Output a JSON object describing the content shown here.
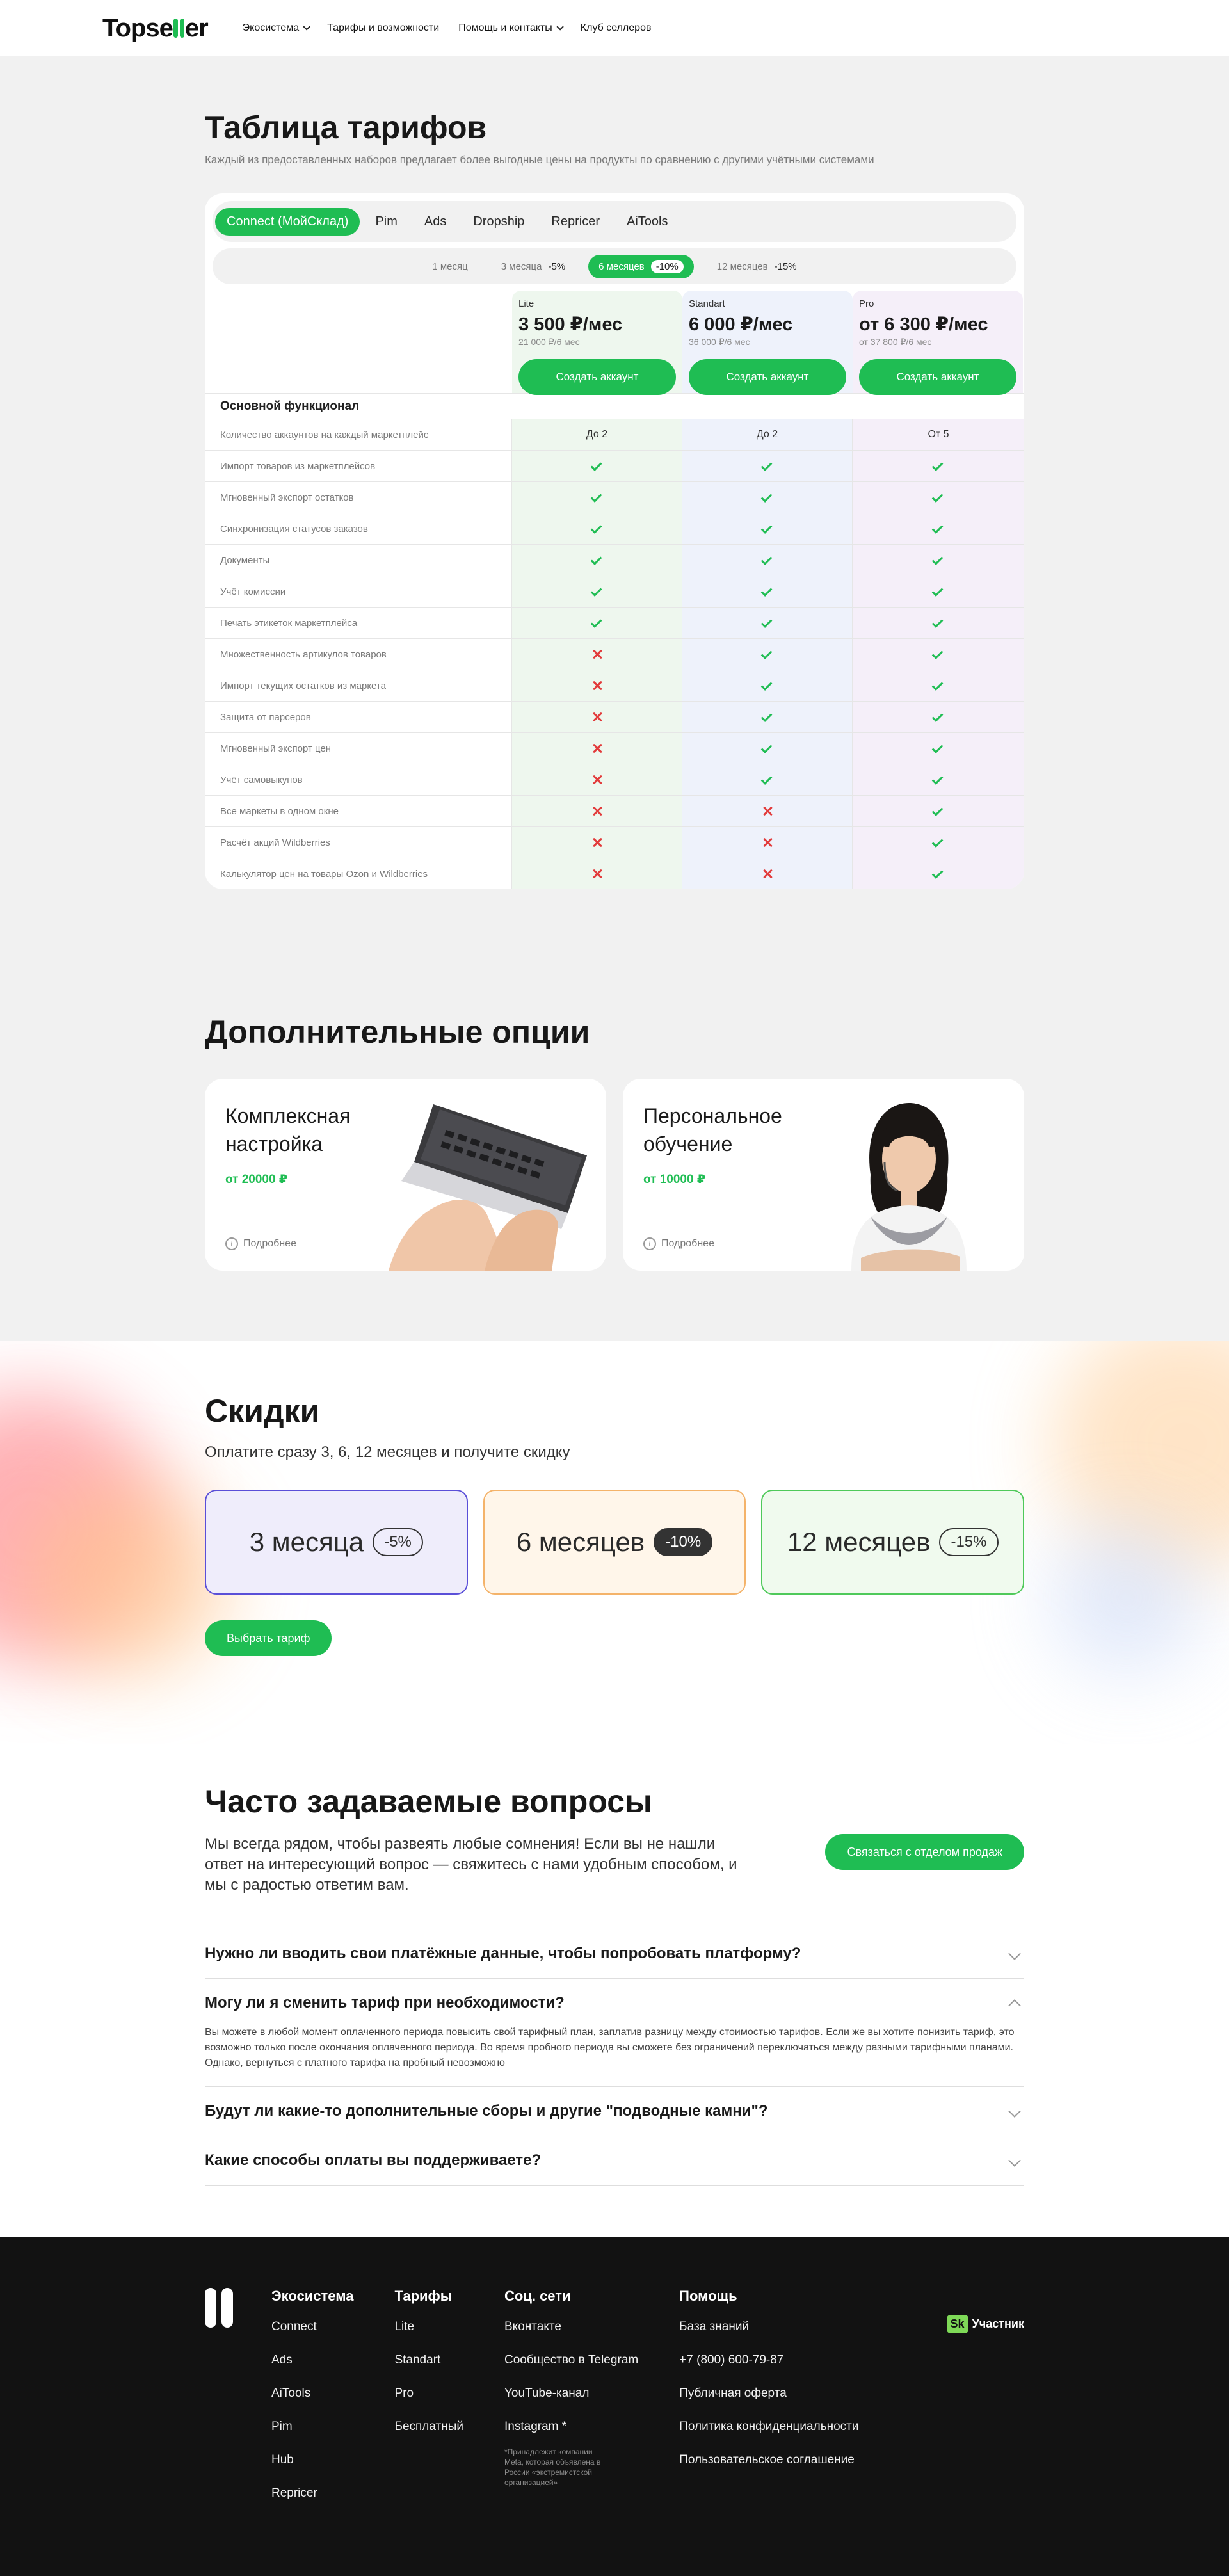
{
  "header": {
    "logo": "Topseller",
    "nav": [
      {
        "label": "Экосистема",
        "dropdown": true
      },
      {
        "label": "Тарифы и возможности",
        "dropdown": false
      },
      {
        "label": "Помощь и контакты",
        "dropdown": true
      },
      {
        "label": "Клуб селлеров",
        "dropdown": false
      }
    ]
  },
  "pricing": {
    "title": "Таблица тарифов",
    "subtitle": "Каждый из предоставленных наборов предлагает более выгодные цены на продукты по сравнению с другими учётными системами",
    "tabs": [
      "Connect (МойСклад)",
      "Pim",
      "Ads",
      "Dropship",
      "Repricer",
      "AiTools"
    ],
    "active_tab": 0,
    "periods": [
      {
        "label": "1 месяц",
        "discount": ""
      },
      {
        "label": "3 месяца",
        "discount": "-5%"
      },
      {
        "label": "6 месяцев",
        "discount": "-10%"
      },
      {
        "label": "12 месяцев",
        "discount": "-15%"
      }
    ],
    "active_period": 2,
    "plans": [
      {
        "name": "Lite",
        "price": "3 500 ₽/мес",
        "price_period": "21 000 ₽/6 мес",
        "button": "Создать аккаунт"
      },
      {
        "name": "Standart",
        "price": "6 000 ₽/мес",
        "price_period": "36 000 ₽/6 мес",
        "button": "Создать аккаунт"
      },
      {
        "name": "Pro",
        "price": "от 6 300 ₽/мес",
        "price_period": "от 37 800 ₽/6 мес",
        "button": "Создать аккаунт"
      }
    ],
    "section_title": "Основной функционал",
    "features": [
      {
        "label": "Количество аккаунтов на каждый маркетплейс",
        "values": [
          "До 2",
          "До 2",
          "От 5"
        ]
      },
      {
        "label": "Импорт товаров из маркетплейсов",
        "values": [
          "yes",
          "yes",
          "yes"
        ]
      },
      {
        "label": "Мгновенный экспорт остатков",
        "values": [
          "yes",
          "yes",
          "yes"
        ]
      },
      {
        "label": "Синхронизация статусов заказов",
        "values": [
          "yes",
          "yes",
          "yes"
        ]
      },
      {
        "label": "Документы",
        "values": [
          "yes",
          "yes",
          "yes"
        ]
      },
      {
        "label": "Учёт комиссии",
        "values": [
          "yes",
          "yes",
          "yes"
        ]
      },
      {
        "label": "Печать этикеток маркетплейса",
        "values": [
          "yes",
          "yes",
          "yes"
        ]
      },
      {
        "label": "Множественность артикулов товаров",
        "values": [
          "no",
          "yes",
          "yes"
        ]
      },
      {
        "label": "Импорт текущих остатков из маркета",
        "values": [
          "no",
          "yes",
          "yes"
        ]
      },
      {
        "label": "Защита от парсеров",
        "values": [
          "no",
          "yes",
          "yes"
        ]
      },
      {
        "label": "Мгновенный экспорт цен",
        "values": [
          "no",
          "yes",
          "yes"
        ]
      },
      {
        "label": "Учёт самовыкупов",
        "values": [
          "no",
          "yes",
          "yes"
        ]
      },
      {
        "label": "Все маркеты в одном окне",
        "values": [
          "no",
          "no",
          "yes"
        ]
      },
      {
        "label": "Расчёт акций Wildberries",
        "values": [
          "no",
          "no",
          "yes"
        ]
      },
      {
        "label": "Калькулятор цен на товары Ozon и Wildberries",
        "values": [
          "no",
          "no",
          "yes"
        ]
      }
    ]
  },
  "options": {
    "title": "Дополнительные опции",
    "cards": [
      {
        "title": "Комплексная настройка",
        "price": "от 20000 ₽",
        "more": "Подробнее",
        "image": "laptop-hands-image"
      },
      {
        "title": "Персональное обучение",
        "price": "от 10000 ₽",
        "more": "Подробнее",
        "image": "support-operator-image"
      }
    ]
  },
  "discounts": {
    "title": "Скидки",
    "subtitle": "Оплатите сразу 3, 6, 12 месяцев и получите скидку",
    "cards": [
      {
        "label": "3 месяца",
        "discount": "-5%"
      },
      {
        "label": "6 месяцев",
        "discount": "-10%"
      },
      {
        "label": "12 месяцев",
        "discount": "-15%"
      }
    ],
    "button": "Выбрать тариф"
  },
  "faq": {
    "title": "Часто задаваемые вопросы",
    "description": "Мы всегда рядом, чтобы развеять любые сомнения! Если вы не нашли ответ на интересующий вопрос — свяжитесь с нами удобным способом, и мы с радостью ответим вам.",
    "contact_button": "Связаться с отделом продаж",
    "items": [
      {
        "question": "Нужно ли вводить свои платёжные данные, чтобы попробовать платформу?",
        "answer": "",
        "open": false
      },
      {
        "question": "Могу ли я сменить тариф при необходимости?",
        "answer": "Вы можете в любой момент оплаченного периода повысить свой тарифный план, заплатив разницу между стоимостью тарифов. Если же вы хотите понизить тариф, это возможно только после окончания оплаченного периода. Во время пробного периода вы сможете без ограничений переключаться между разными тарифными планами. Однако, вернуться с платного тарифа на пробный невозможно",
        "open": true
      },
      {
        "question": "Будут ли какие-то дополнительные сборы и другие \"подводные камни\"?",
        "answer": "",
        "open": false
      },
      {
        "question": "Какие способы оплаты вы поддерживаете?",
        "answer": "",
        "open": false
      }
    ]
  },
  "footer": {
    "columns": [
      {
        "title": "Экосистема",
        "items": [
          "Connect",
          "Ads",
          "AiTools",
          "Pim",
          "Hub",
          "Repricer"
        ]
      },
      {
        "title": "Тарифы",
        "items": [
          "Lite",
          "Standart",
          "Pro",
          "Бесплатный"
        ]
      },
      {
        "title": "Соц. сети",
        "items": [
          "Вконтакте",
          "Сообщество в Telegram",
          "YouTube-канал",
          "Instagram *"
        ]
      },
      {
        "title": "Помощь",
        "items": [
          "База знаний",
          "+7 (800) 600-79-87",
          "Публичная оферта",
          "Политика конфиденциальности",
          "Пользовательское соглашение"
        ]
      }
    ],
    "instagram_note": "*Принадлежит компании Meta, которая объявлена в России «экстремистской организацией»",
    "badge_logo": "Sk",
    "badge_text": "Участник"
  },
  "colors": {
    "accent": "#1fbd53",
    "lite_column": "#eef7ee",
    "standart_column": "#eef2fb",
    "pro_column": "#f5eff9",
    "cross": "#e23b3b",
    "footer_bg": "#121212"
  }
}
